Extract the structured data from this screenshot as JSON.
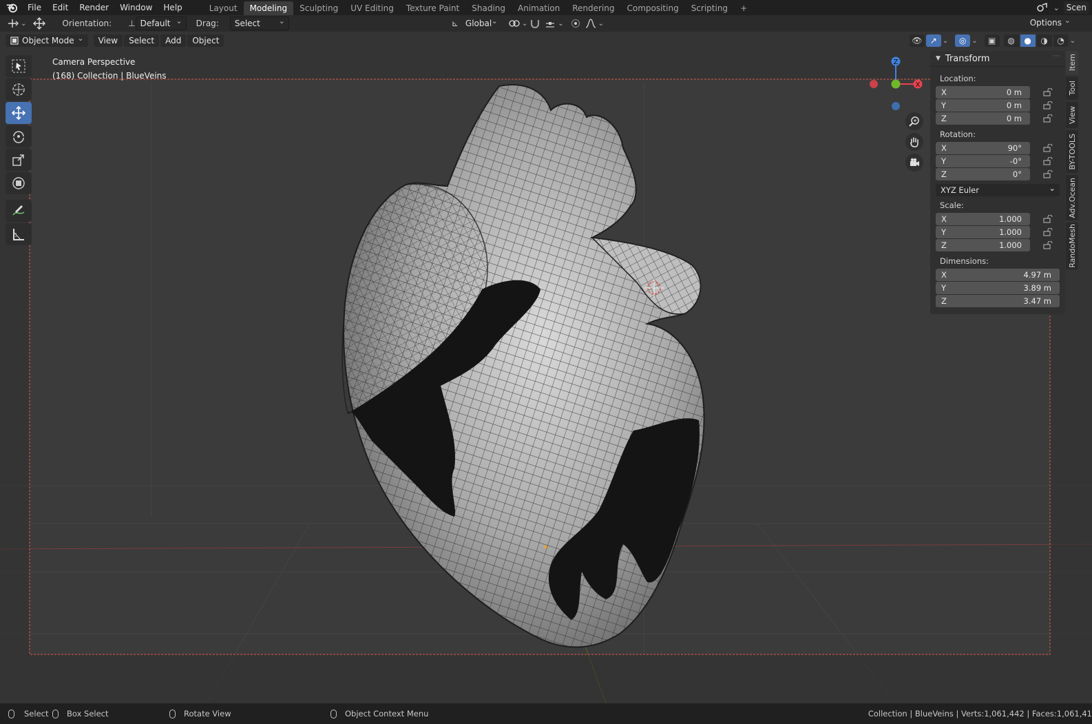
{
  "topbar": {
    "menus": [
      "File",
      "Edit",
      "Render",
      "Window",
      "Help"
    ],
    "workspaces": [
      "Layout",
      "Modeling",
      "Sculpting",
      "UV Editing",
      "Texture Paint",
      "Shading",
      "Animation",
      "Rendering",
      "Compositing",
      "Scripting"
    ],
    "active_workspace": "Modeling",
    "add_tab": "+",
    "scene_label": "Scen"
  },
  "toolheader": {
    "orientation_label": "Orientation:",
    "orientation_value": "Default",
    "drag_label": "Drag:",
    "drag_value": "Select Box",
    "transform_orientation": "Global",
    "options_label": "Options"
  },
  "viewheader": {
    "mode": "Object Mode",
    "menus": [
      "View",
      "Select",
      "Add",
      "Object"
    ]
  },
  "viewport": {
    "camera_label": "Camera Perspective",
    "collection_label": "(168) Collection | BlueVeins"
  },
  "gizmo": {
    "z_label": "Z",
    "x_label": "X",
    "y_label": "Y"
  },
  "npanel": {
    "title": "Transform",
    "location_label": "Location:",
    "location": [
      {
        "axis": "X",
        "value": "0 m"
      },
      {
        "axis": "Y",
        "value": "0 m"
      },
      {
        "axis": "Z",
        "value": "0 m"
      }
    ],
    "rotation_label": "Rotation:",
    "rotation": [
      {
        "axis": "X",
        "value": "90°"
      },
      {
        "axis": "Y",
        "value": "-0°"
      },
      {
        "axis": "Z",
        "value": "0°"
      }
    ],
    "rotation_mode": "XYZ Euler",
    "scale_label": "Scale:",
    "scale": [
      {
        "axis": "X",
        "value": "1.000"
      },
      {
        "axis": "Y",
        "value": "1.000"
      },
      {
        "axis": "Z",
        "value": "1.000"
      }
    ],
    "dimensions_label": "Dimensions:",
    "dimensions": [
      {
        "axis": "X",
        "value": "4.97 m"
      },
      {
        "axis": "Y",
        "value": "3.89 m"
      },
      {
        "axis": "Z",
        "value": "3.47 m"
      }
    ]
  },
  "sidetabs": [
    "Item",
    "Tool",
    "View",
    "BY-TOOLS",
    "Adv.Ocean",
    "RandoMesh"
  ],
  "statusbar": {
    "select": "Select",
    "box_select": "Box Select",
    "rotate_view": "Rotate View",
    "context_menu": "Object Context Menu",
    "stats": "Collection | BlueVeins | Verts:1,061,442 | Faces:1,061,41"
  },
  "colors": {
    "accent": "#4772b3",
    "x_axis": "#e8434f",
    "y_axis": "#6fb82a",
    "z_axis": "#3f84e0",
    "camera_frame": "#e2584a"
  }
}
